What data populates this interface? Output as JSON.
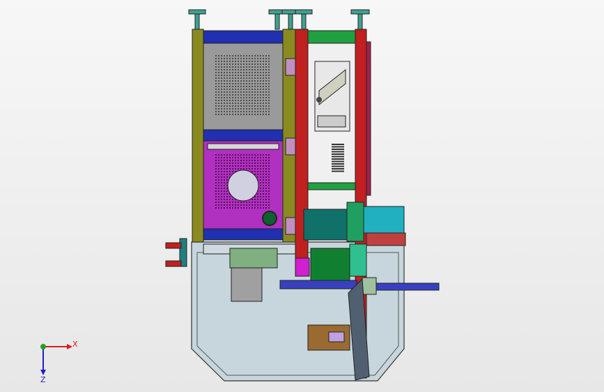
{
  "viewport": {
    "background_top": "#f7f7f7",
    "background_bottom": "#e7e7e7"
  },
  "triad": {
    "x_label": "X",
    "z_label": "Z",
    "x_color": "#d42020",
    "z_color": "#2020c8",
    "y_color": "#20a020"
  },
  "colors": {
    "frame_olive": "#8a8a20",
    "panel_blue": "#2030b0",
    "panel_grey": "#9a9a9a",
    "panel_magenta": "#b030c0",
    "rail_red": "#c02020",
    "rail_green": "#20a040",
    "motor_teal": "#10706a",
    "motor_green": "#108030",
    "box_cyan": "#20b0c0",
    "enclosure_fill": "#c6d6dc",
    "shaft_blue": "#3840c0",
    "foot_teal": "#40a090"
  }
}
